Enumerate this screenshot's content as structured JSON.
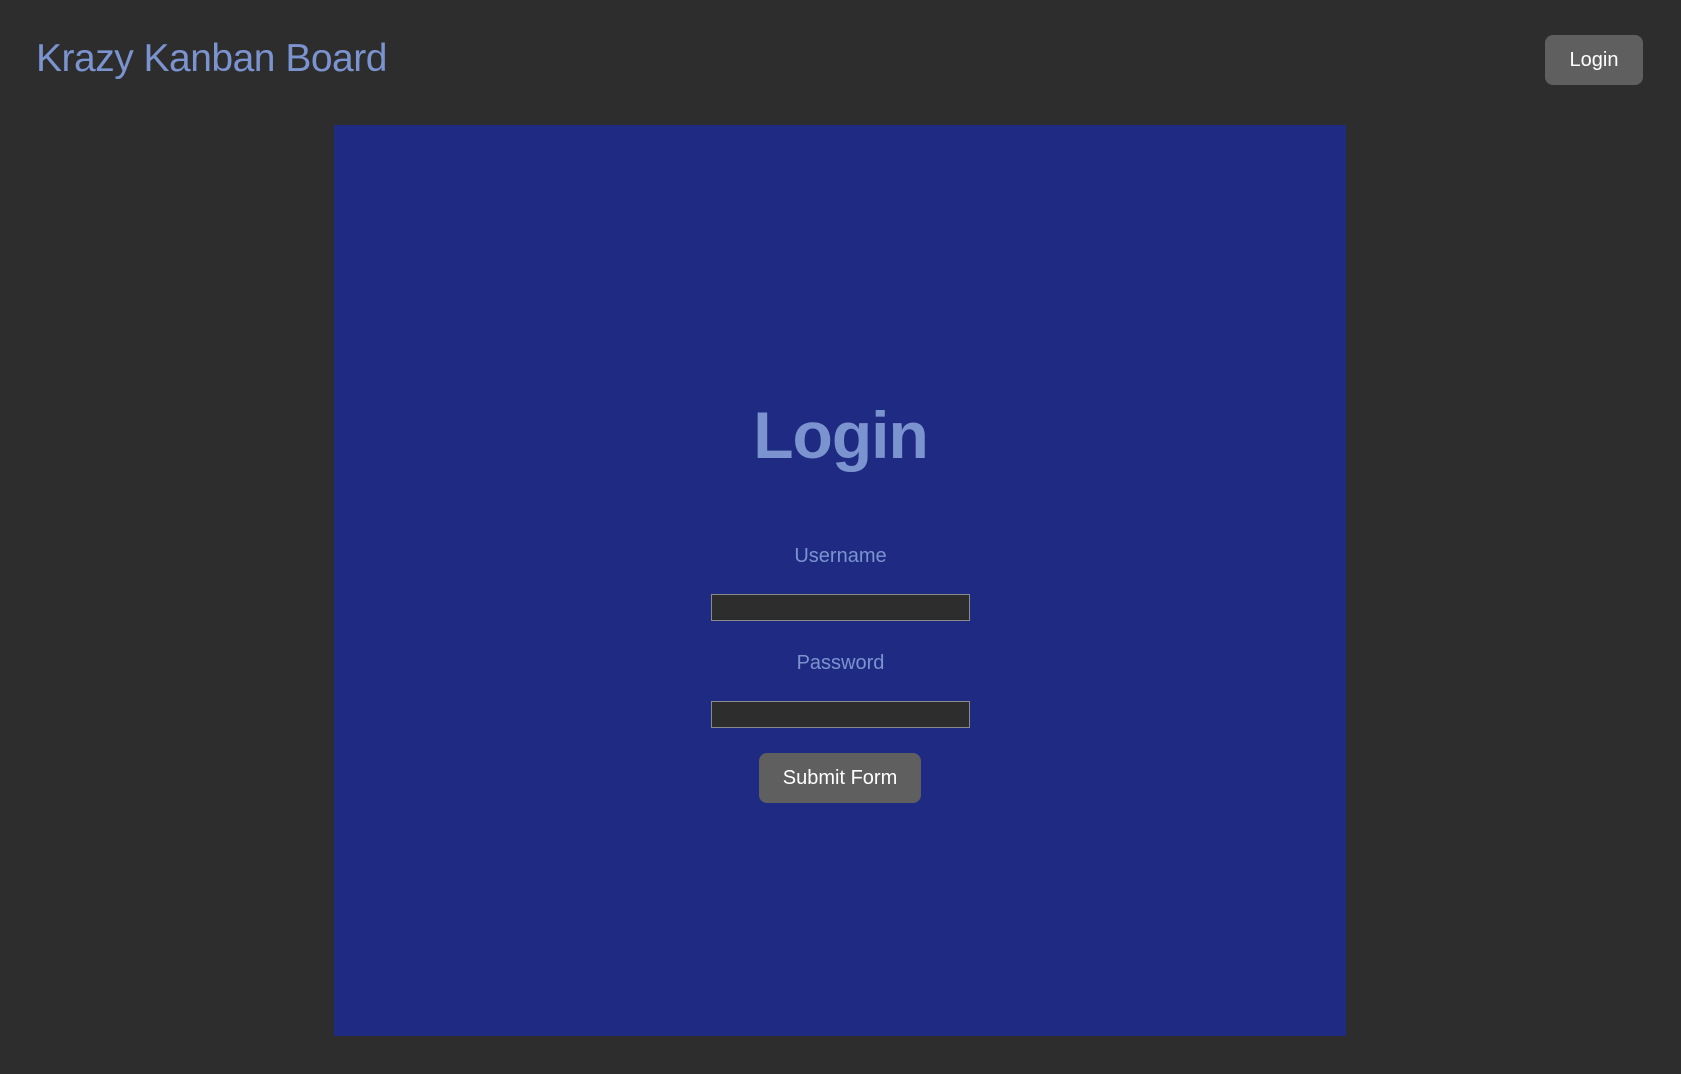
{
  "header": {
    "title": "Krazy Kanban Board",
    "login_button_label": "Login"
  },
  "login_form": {
    "heading": "Login",
    "username_label": "Username",
    "username_value": "",
    "password_label": "Password",
    "password_value": "",
    "submit_label": "Submit Form"
  },
  "colors": {
    "page_background": "#2d2d2d",
    "panel_background": "#1f2b82",
    "accent_text": "#7b93cf",
    "button_background": "#5f5f5f",
    "button_text": "#ffffff",
    "input_background": "#2d2d2d"
  }
}
